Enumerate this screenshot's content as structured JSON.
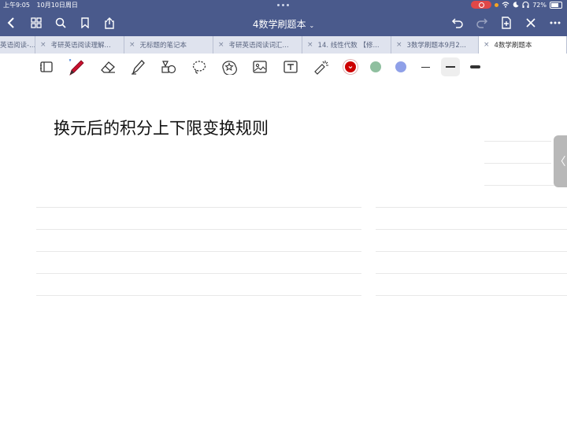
{
  "status_bar": {
    "time": "上午9:05",
    "date": "10月10日周日",
    "battery": "72%",
    "battery_level": 0.72
  },
  "header": {
    "title": "4数学刷题本",
    "title_caret": "⌄"
  },
  "tabs": [
    {
      "label": "英语阅读-..."
    },
    {
      "label": "考研英语阅读理解..."
    },
    {
      "label": "无标题的笔记本"
    },
    {
      "label": "考研英语阅读词汇..."
    },
    {
      "label": "14. 线性代数 【修..."
    },
    {
      "label": "3数学刷题本9月2..."
    },
    {
      "label": "4数学刷题本",
      "active": true
    }
  ],
  "tab_close": "×",
  "toolbar": {
    "colors": [
      "#cc0000",
      "#8fbf9f",
      "#8fa0e8"
    ],
    "accent": "#4a5a8c"
  },
  "note": {
    "heading": "换元后的积分上下限变换规则"
  },
  "side_handle": "〈"
}
